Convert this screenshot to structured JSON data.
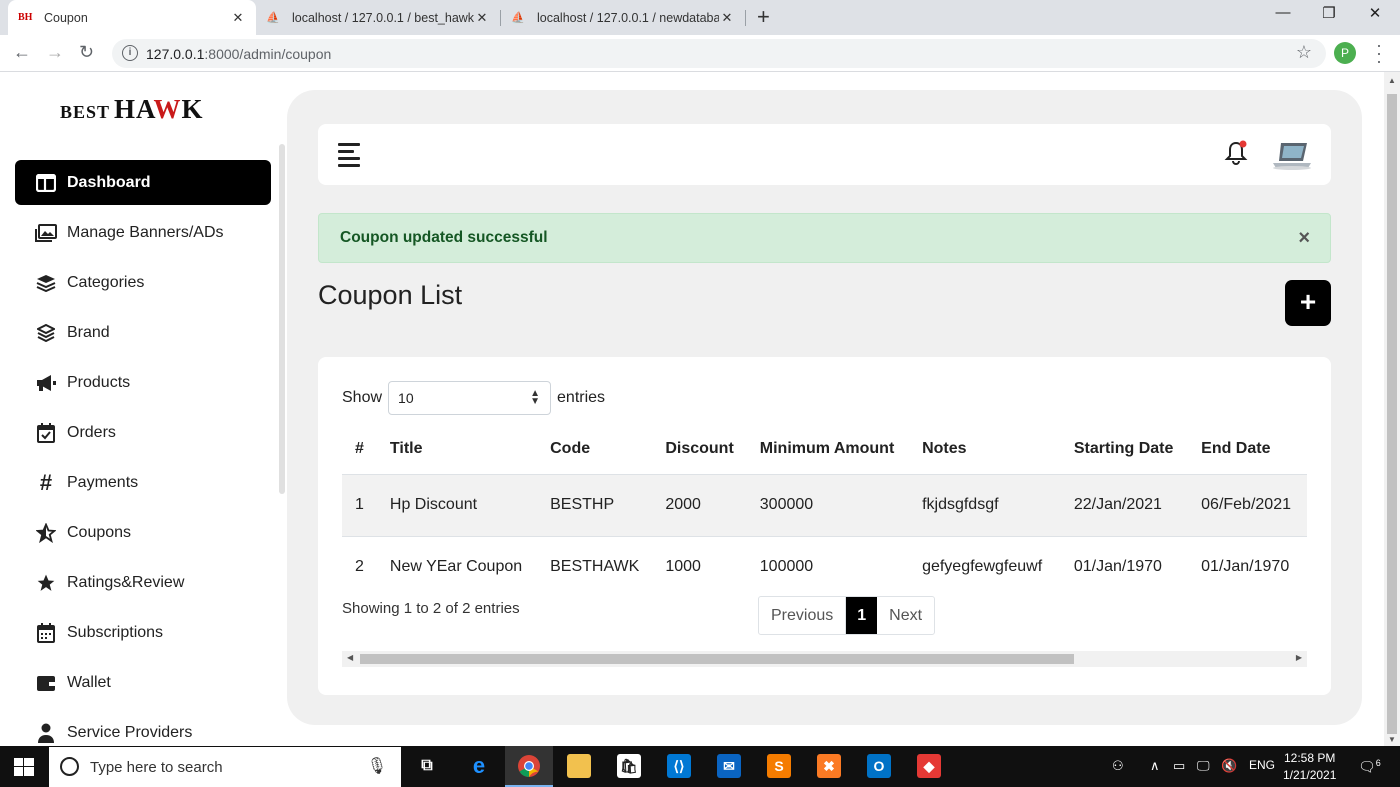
{
  "browser": {
    "tabs": [
      {
        "favicon": "BH",
        "title": "Coupon",
        "active": true
      },
      {
        "favicon": "PMA",
        "title": "localhost / 127.0.0.1 / best_hawk",
        "active": false
      },
      {
        "favicon": "PMA",
        "title": "localhost / 127.0.0.1 / newdataba",
        "active": false
      }
    ],
    "url_host": "127.0.0.1",
    "url_rest": ":8000/admin/coupon",
    "profile_initial": "P"
  },
  "logo": {
    "prefix": "BEST",
    "name_a": "HA",
    "name_w": "W",
    "name_k": "K"
  },
  "sidebar": {
    "items": [
      {
        "label": "Dashboard",
        "icon": "dashboard-icon"
      },
      {
        "label": "Manage Banners/ADs",
        "icon": "images-icon"
      },
      {
        "label": "Categories",
        "icon": "layers-icon"
      },
      {
        "label": "Brand",
        "icon": "stack-icon"
      },
      {
        "label": "Products",
        "icon": "megaphone-icon"
      },
      {
        "label": "Orders",
        "icon": "calendar-check-icon"
      },
      {
        "label": "Payments",
        "icon": "hash-icon"
      },
      {
        "label": "Coupons",
        "icon": "star-half-icon"
      },
      {
        "label": "Ratings&Review",
        "icon": "star-icon"
      },
      {
        "label": "Subscriptions",
        "icon": "calendar-icon"
      },
      {
        "label": "Wallet",
        "icon": "wallet-icon"
      },
      {
        "label": "Service Providers",
        "icon": "user-tie-icon"
      }
    ]
  },
  "alert": {
    "message": "Coupon updated successful",
    "close": "×"
  },
  "page": {
    "title": "Coupon List",
    "add_label": "+"
  },
  "table_controls": {
    "show": "Show",
    "entries_value": "10",
    "entries": "entries"
  },
  "table": {
    "headers": [
      "#",
      "Title",
      "Code",
      "Discount",
      "Minimum Amount",
      "Notes",
      "Starting Date",
      "End Date"
    ],
    "rows": [
      [
        "1",
        "Hp Discount",
        "BESTHP",
        "2000",
        "300000",
        "fkjdsgfdsgf",
        "22/Jan/2021",
        "06/Feb/2021"
      ],
      [
        "2",
        "New YEar Coupon",
        "BESTHAWK",
        "1000",
        "100000",
        "gefyegfewgfeuwf",
        "01/Jan/1970",
        "01/Jan/1970"
      ]
    ]
  },
  "pagination": {
    "info": "Showing 1 to 2 of 2 entries",
    "previous": "Previous",
    "current": "1",
    "next": "Next"
  },
  "taskbar": {
    "search_placeholder": "Type here to search",
    "language": "ENG",
    "time": "12:58 PM",
    "date": "1/21/2021",
    "notifications": "6"
  }
}
